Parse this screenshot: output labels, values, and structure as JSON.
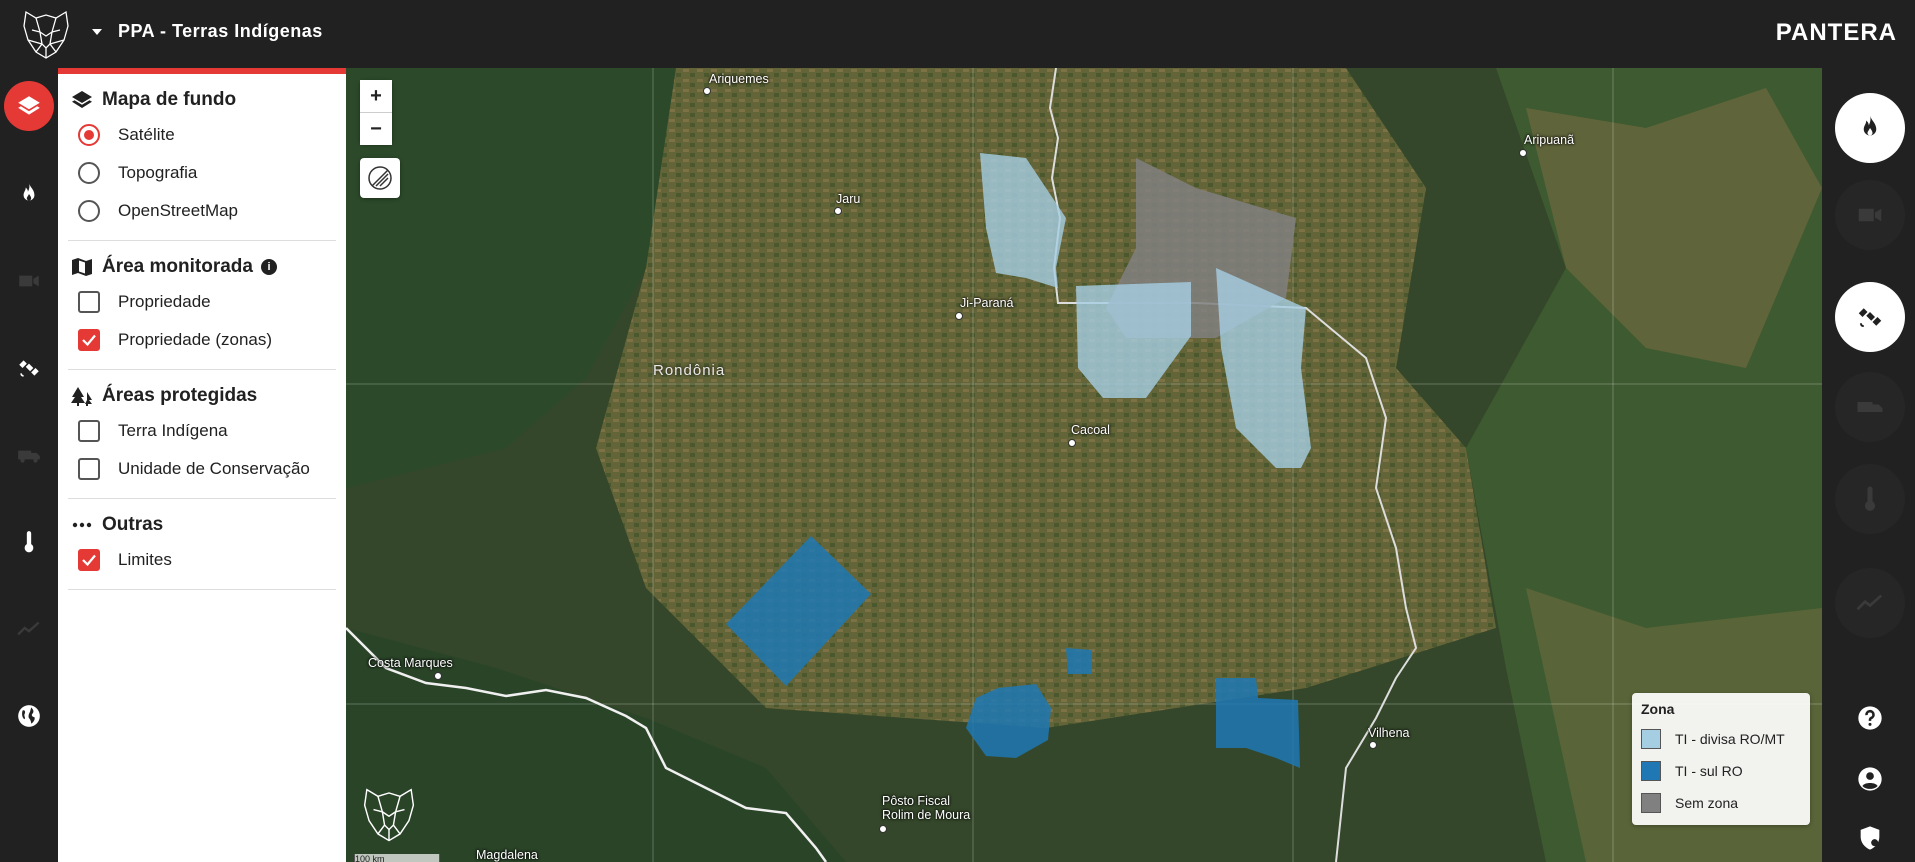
{
  "header": {
    "project_title": "PPA - Terras Indígenas",
    "brand": "PANTERA"
  },
  "left_rail": [
    {
      "icon": "layers-icon",
      "active": true
    },
    {
      "icon": "fire-icon",
      "active": false
    },
    {
      "icon": "camera-icon",
      "active": false
    },
    {
      "icon": "satellite-icon",
      "active": false
    },
    {
      "icon": "firetruck-icon",
      "active": false
    },
    {
      "icon": "thermometer-icon",
      "active": false
    },
    {
      "icon": "chart-line-icon",
      "active": false
    },
    {
      "icon": "globe-icon",
      "active": false
    }
  ],
  "panel": {
    "basemap": {
      "title": "Mapa de fundo",
      "options": [
        "Satélite",
        "Topografia",
        "OpenStreetMap"
      ],
      "selected": "Satélite"
    },
    "monitored": {
      "title": "Área monitorada",
      "info": "i",
      "options": [
        {
          "label": "Propriedade",
          "checked": false
        },
        {
          "label": "Propriedade (zonas)",
          "checked": true
        }
      ]
    },
    "protected": {
      "title": "Áreas protegidas",
      "options": [
        {
          "label": "Terra Indígena",
          "checked": false
        },
        {
          "label": "Unidade de Conservação",
          "checked": false
        }
      ]
    },
    "others": {
      "title": "Outras",
      "options": [
        {
          "label": "Limites",
          "checked": true
        }
      ]
    }
  },
  "map": {
    "zoom_in": "+",
    "zoom_out": "−",
    "state_label": "Rondônia",
    "cities": [
      "Ariquemes",
      "Jaru",
      "Ji-Paraná",
      "Aripuanã",
      "Cacoal",
      "Costa Marques",
      "Vilhena",
      "Pôsto Fiscal",
      "Rolim de Moura",
      "Magdalena"
    ],
    "scale": "100 km",
    "legend": {
      "title": "Zona",
      "items": [
        {
          "label": "TI - divisa RO/MT",
          "color": "#a6cee3"
        },
        {
          "label": "TI - sul RO",
          "color": "#1f78b4"
        },
        {
          "label": "Sem zona",
          "color": "#808080"
        }
      ]
    }
  },
  "right_rail": [
    {
      "icon": "fire-icon",
      "active": true
    },
    {
      "icon": "camera-icon",
      "active": false
    },
    {
      "icon": "satellite-icon",
      "active": true
    },
    {
      "icon": "firetruck-icon",
      "active": false
    },
    {
      "icon": "thermometer-icon",
      "active": false
    },
    {
      "icon": "chart-line-icon",
      "active": false
    }
  ],
  "utilities": [
    "help-icon",
    "account-icon",
    "shield-icon"
  ]
}
